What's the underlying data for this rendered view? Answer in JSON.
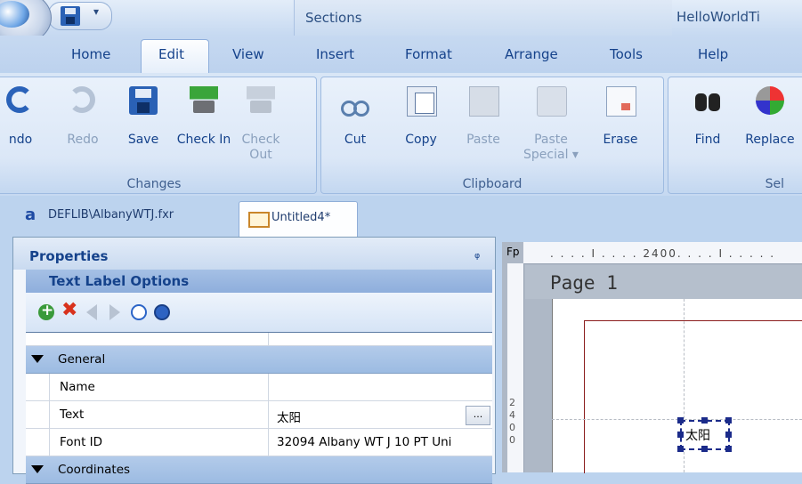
{
  "window": {
    "title": "HelloWorldTi"
  },
  "quick_access": {
    "dropdown_glyph": "▾"
  },
  "contextual_group": {
    "label": "Sections"
  },
  "tabs": [
    {
      "label": "Home"
    },
    {
      "label": "Edit",
      "selected": true
    },
    {
      "label": "View"
    },
    {
      "label": "Insert"
    },
    {
      "label": "Format"
    },
    {
      "label": "Arrange"
    },
    {
      "label": "Tools"
    },
    {
      "label": "Help"
    }
  ],
  "ribbon": {
    "changes": {
      "label": "Changes",
      "buttons": {
        "undo": "ndo",
        "redo": "Redo",
        "save": "Save",
        "checkin": "Check In",
        "checkout": "Check Out"
      }
    },
    "clipboard": {
      "label": "Clipboard",
      "buttons": {
        "cut": "Cut",
        "copy": "Copy",
        "paste": "Paste",
        "paste_special": "Paste Special ▾",
        "erase": "Erase"
      }
    },
    "select": {
      "label": "Sel",
      "buttons": {
        "find": "Find",
        "replace": "Replace"
      }
    }
  },
  "doc_tabs": [
    {
      "label": "DEFLIB\\AlbanyWTJ.fxr",
      "icon_glyph": "a"
    },
    {
      "label": "Untitled4*",
      "active": true
    }
  ],
  "properties": {
    "title": "Properties",
    "pin_glyph": "ᵩ",
    "section_title": "Text Label Options",
    "toolbar": {
      "delete_glyph": "✖"
    },
    "rows": [
      {
        "kind": "category",
        "name": "General"
      },
      {
        "kind": "prop",
        "name": "Name",
        "value": ""
      },
      {
        "kind": "prop",
        "name": "Text",
        "value": "太阳",
        "ellipsis": "..."
      },
      {
        "kind": "prop",
        "name": "Font ID",
        "value": "32094 Albany WT J 10 PT Uni"
      },
      {
        "kind": "category",
        "name": "Coordinates"
      }
    ]
  },
  "canvas": {
    "corner_label": "Fp",
    "ruler_text": ". . . . I . . . . 2400. . . . I . . . . .",
    "vruler_text": "2 4 0 0",
    "page_label": "Page 1",
    "text_label": "太阳"
  }
}
